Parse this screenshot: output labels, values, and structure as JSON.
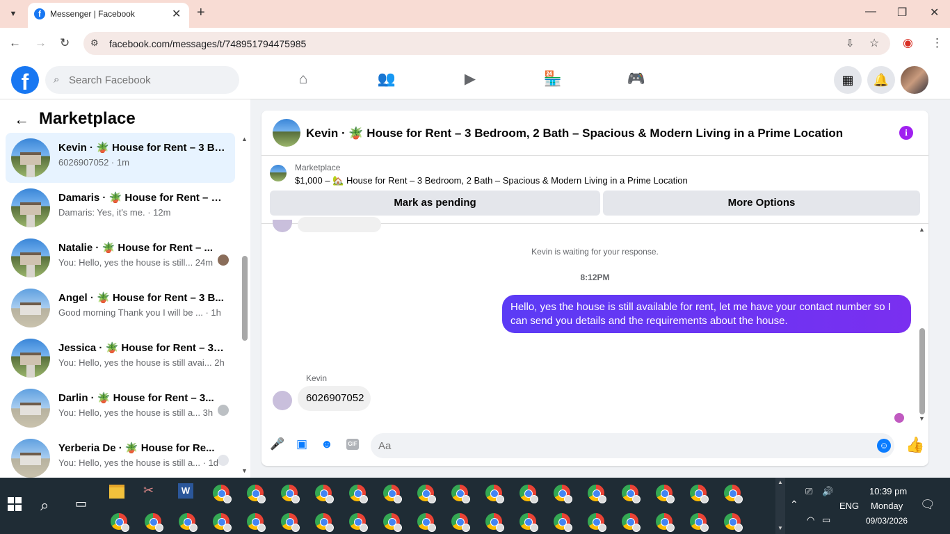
{
  "browser": {
    "tab_title": "Messenger | Facebook",
    "url": "facebook.com/messages/t/748951794475985"
  },
  "facebook": {
    "search_placeholder": "Search Facebook"
  },
  "sidebar": {
    "title": "Marketplace",
    "conversations": [
      {
        "name": "Kevin · 🪴 House for Rent – 3 Be...",
        "preview": "6026907052 · 1m",
        "active": true
      },
      {
        "name": "Damaris · 🪴 House for Rent – 3 ...",
        "preview": "Damaris: Yes, it's me. · 12m"
      },
      {
        "name": "Natalie · 🪴 House for Rent – ...",
        "preview": "You: Hello, yes the house is still...  24m"
      },
      {
        "name": "Angel · 🪴 House for Rent – 3 B...",
        "preview": "Good morning Thank you I will be ...  · 1h"
      },
      {
        "name": "Jessica · 🪴 House for Rent – 3 B...",
        "preview": "You: Hello, yes the house is still avai...  2h"
      },
      {
        "name": "Darlin · 🪴 House for Rent – 3...",
        "preview": "You: Hello, yes the house is still a...  3h"
      },
      {
        "name": "Yerberia De · 🪴 House for Re...",
        "preview": "You: Hello, yes the house is still a...  · 1d"
      }
    ]
  },
  "chat": {
    "title": "Kevin · 🪴 House for Rent – 3 Bedroom, 2 Bath – Spacious & Modern Living in a Prime Location",
    "marketplace_label": "Marketplace",
    "listing": "$1,000 – 🏡 House for Rent – 3 Bedroom, 2 Bath – Spacious & Modern Living in a Prime Location",
    "mark_pending": "Mark as pending",
    "more_options": "More Options",
    "waiting": "Kevin is waiting for your response.",
    "timestamp": "8:12PM",
    "outgoing": "Hello, yes the house is still available for rent, let me have your contact number so I can send you details and the requirements about the house.",
    "incoming_sender": "Kevin",
    "incoming": "6026907052",
    "composer_placeholder": "Aa",
    "gif_label": "GIF"
  },
  "taskbar": {
    "language": "ENG",
    "time": "10:39 pm",
    "day": "Monday",
    "date": "09/03/2026"
  },
  "colors": {
    "fb_blue": "#1877f2",
    "bubble": "#7a2ff0",
    "taskbar": "#1f2c35"
  }
}
